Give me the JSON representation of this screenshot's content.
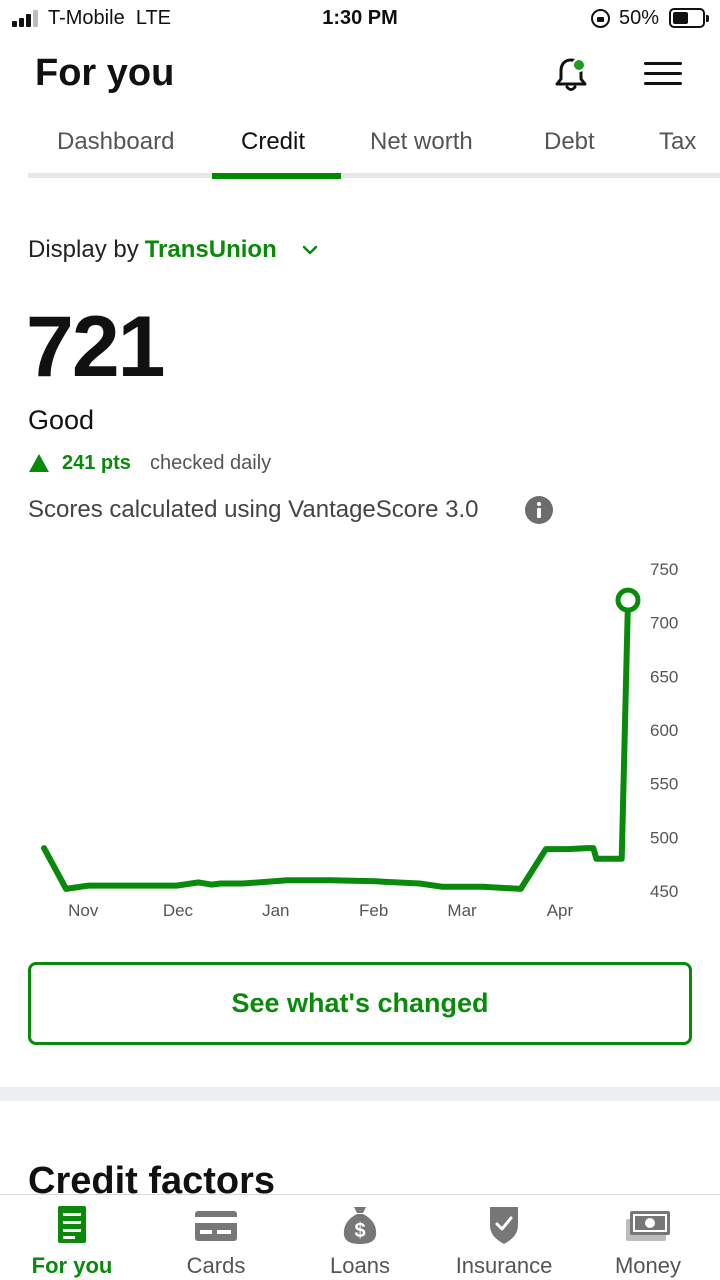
{
  "status_bar": {
    "carrier": "T-Mobile",
    "network": "LTE",
    "time": "1:30 PM",
    "battery": "50%"
  },
  "header": {
    "title": "For you",
    "icons": [
      "bell-icon",
      "menu-icon"
    ],
    "notification_dot_color": "#1e9e1e"
  },
  "tabs": [
    {
      "label": "Dashboard",
      "active": false
    },
    {
      "label": "Credit",
      "active": true
    },
    {
      "label": "Net worth",
      "active": false
    },
    {
      "label": "Debt",
      "active": false
    },
    {
      "label": "Tax",
      "active": false
    }
  ],
  "credit": {
    "display_by_label": "Display by",
    "bureau": "TransUnion",
    "score": "721",
    "rating": "Good",
    "change": "241 pts",
    "change_direction": "up",
    "frequency": "checked daily",
    "model_note": "Scores calculated using VantageScore 3.0"
  },
  "chart_data": {
    "type": "line",
    "x_tick_labels": [
      "Nov",
      "Dec",
      "Jan",
      "Feb",
      "Mar",
      "Apr"
    ],
    "y_tick_labels": [
      "750",
      "700",
      "650",
      "600",
      "550",
      "500",
      "450"
    ],
    "ylim": [
      450,
      750
    ],
    "y_axis_side": "right",
    "grid": false,
    "line_color": "#0a8a0a",
    "points": [
      {
        "x": "Oct 24",
        "y": 490
      },
      {
        "x": "Oct 31",
        "y": 452
      },
      {
        "x": "Nov 7",
        "y": 455
      },
      {
        "x": "Nov 21",
        "y": 455
      },
      {
        "x": "Dec 5",
        "y": 455
      },
      {
        "x": "Dec 12",
        "y": 458
      },
      {
        "x": "Dec 16",
        "y": 456
      },
      {
        "x": "Dec 19",
        "y": 457
      },
      {
        "x": "Dec 26",
        "y": 457
      },
      {
        "x": "Jan 9",
        "y": 460
      },
      {
        "x": "Jan 23",
        "y": 460
      },
      {
        "x": "Feb 6",
        "y": 459
      },
      {
        "x": "Feb 20",
        "y": 457
      },
      {
        "x": "Feb 27",
        "y": 454
      },
      {
        "x": "Mar 12",
        "y": 454
      },
      {
        "x": "Mar 24",
        "y": 452
      },
      {
        "x": "Apr 1",
        "y": 489
      },
      {
        "x": "Apr 8",
        "y": 489
      },
      {
        "x": "Apr 14",
        "y": 490
      },
      {
        "x": "Apr 16",
        "y": 490
      },
      {
        "x": "Apr 17",
        "y": 480
      },
      {
        "x": "Apr 25",
        "y": 480
      },
      {
        "x": "Apr 27",
        "y": 721
      }
    ]
  },
  "cta": {
    "label": "See what's changed"
  },
  "section": {
    "title": "Credit factors"
  },
  "bottom_nav": [
    {
      "label": "For you",
      "icon": "document-icon",
      "active": true
    },
    {
      "label": "Cards",
      "icon": "credit-card-icon",
      "active": false
    },
    {
      "label": "Loans",
      "icon": "money-bag-icon",
      "active": false
    },
    {
      "label": "Insurance",
      "icon": "shield-check-icon",
      "active": false
    },
    {
      "label": "Money",
      "icon": "banknote-icon",
      "active": false
    }
  ],
  "colors": {
    "accent": "#0a8a0a",
    "muted_icon": "#777777"
  }
}
